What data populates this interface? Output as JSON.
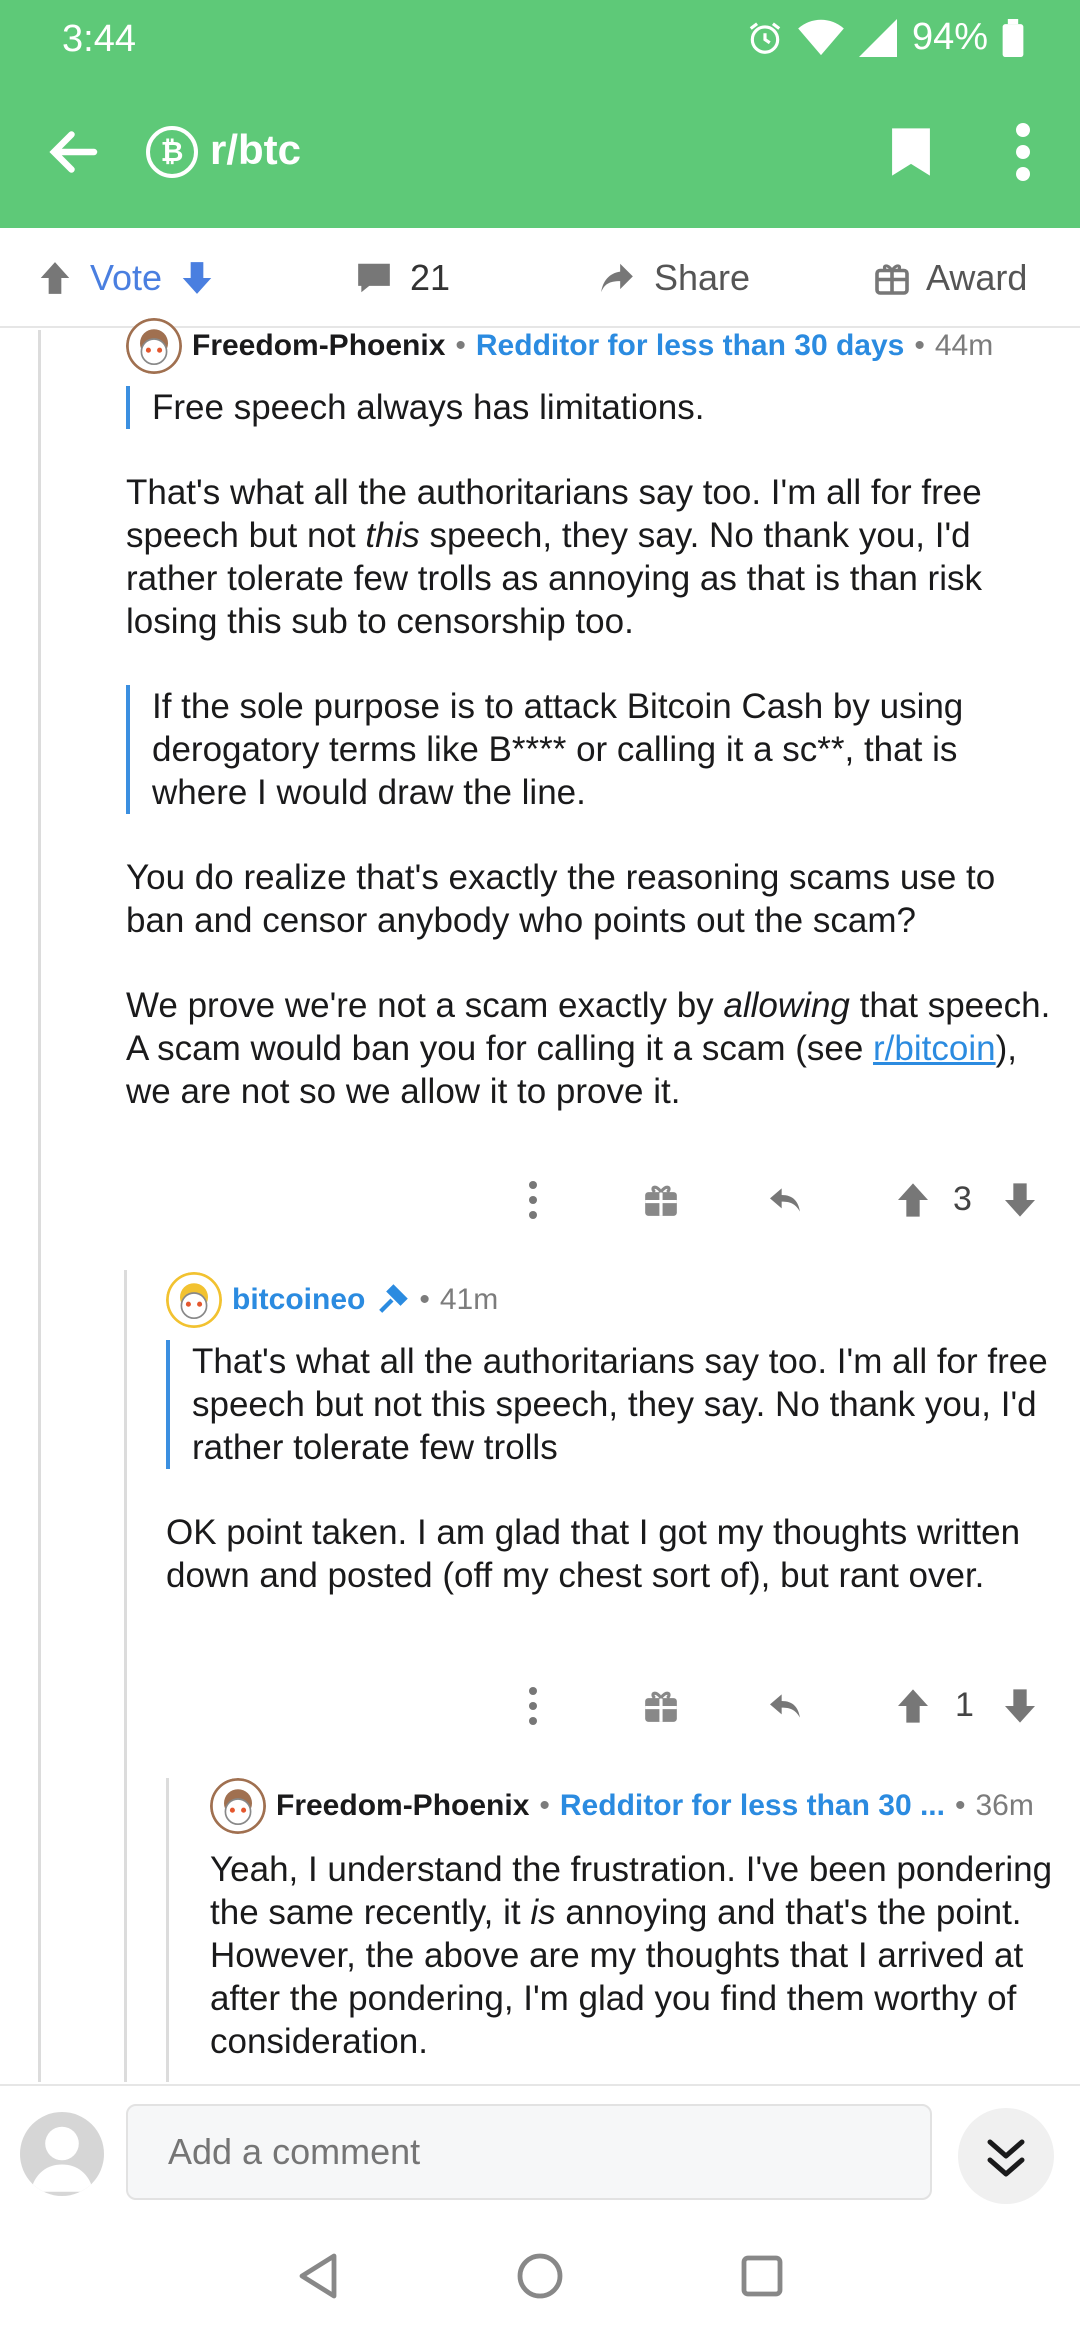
{
  "status": {
    "time": "3:44",
    "battery": "94%"
  },
  "appbar": {
    "subreddit": "r/btc",
    "sub_icon_glyph": "₿"
  },
  "actions": {
    "vote": "Vote",
    "comments": "21",
    "share": "Share",
    "award": "Award"
  },
  "comments": [
    {
      "user": "Freedom-Phoenix",
      "flair": "Redditor for less than 30 days",
      "age": "44m",
      "quote1": "Free speech always has limitations.",
      "p1a": "That's what all the authoritarians say too. I'm all for free speech but not ",
      "p1em": "this",
      "p1b": " speech, they say. No thank you, I'd rather tolerate few trolls as annoying as that is than risk losing this sub to censorship too.",
      "quote2": "If the sole purpose is to attack Bitcoin Cash by using derogatory terms like B**** or calling it a sc**, that is where I would draw the line.",
      "p2": "You do realize that's exactly the reasoning scams use to ban and censor anybody who points out the scam?",
      "p3a": "We prove we're not a scam exactly by ",
      "p3em": "allowing",
      "p3b": " that speech. A scam would ban you for calling it a scam (see ",
      "p3link": "r/bitcoin",
      "p3c": "), we are not so we allow it to prove it.",
      "score": "3"
    },
    {
      "user": "bitcoineo",
      "age": "41m",
      "quote": "That's what all the authoritarians say too. I'm all for free speech but not this speech, they say. No thank you, I'd rather tolerate few trolls",
      "p1": "OK point taken. I am glad that I got my thoughts written down and posted (off my chest sort of), but rant over.",
      "score": "1"
    },
    {
      "user": "Freedom-Phoenix",
      "flair": "Redditor for less than 30 ...",
      "age": "36m",
      "p1a": "Yeah, I understand the frustration. I've been pondering the same recently, it ",
      "p1em": "is",
      "p1b": " annoying and that's the point. However, the above are my thoughts that I arrived at after the pondering, I'm glad you find them worthy of consideration."
    }
  ],
  "composer": {
    "placeholder": "Add a comment"
  },
  "colors": {
    "header": "#5ec978",
    "accent": "#2b8be0",
    "quote_bar": "#3b8fe0"
  }
}
